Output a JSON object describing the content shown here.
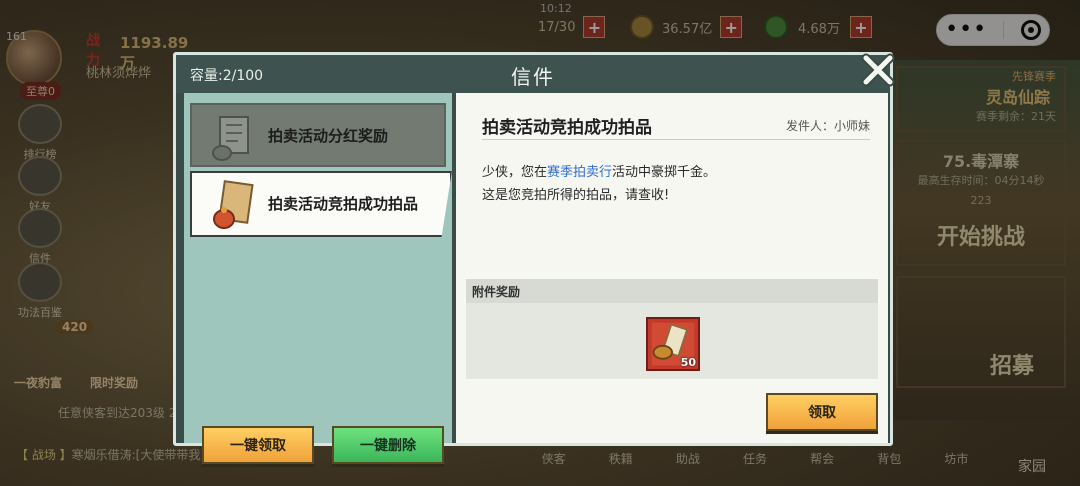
{
  "hud": {
    "level": "161",
    "power_label": "战力",
    "power": "1193.89万",
    "player_name": "桃林须烨烨",
    "rank": "至尊0",
    "timer": "10:12",
    "energy": "17/30",
    "copper": "36.57亿",
    "jade": "4.68万",
    "plus": "+"
  },
  "side_menu": [
    {
      "label": "排行榜"
    },
    {
      "label": "好友"
    },
    {
      "label": "信件"
    },
    {
      "label": "功法百鉴"
    }
  ],
  "bottom": {
    "reward_badge": "420",
    "act_1": "一夜豹富",
    "act_2": "限时奖励",
    "task": "任意侠客到达203级 2",
    "chat_tag": "【 战场 】",
    "chat_text": "寒烟乐借涛:[大使带带我]",
    "nav": [
      "侠客",
      "秩籍",
      "助战",
      "任务",
      "帮会",
      "背包",
      "坊市"
    ],
    "home": "家园"
  },
  "right_panels": {
    "season_tag": "先锋赛季",
    "season_title": "灵岛仙踪",
    "season_sub": "赛季剩余：21天",
    "dungeon_title": "75.毒潭寨",
    "dungeon_sub": "最高生存时间：04分14秒",
    "dungeon_count": "223",
    "challenge": "开始挑战",
    "recruit": "招募"
  },
  "dialog": {
    "capacity": "容量:2/100",
    "title": "信件",
    "mails": [
      {
        "label": "拍卖活动分红奖励",
        "state": "read"
      },
      {
        "label": "拍卖活动竞拍成功拍品",
        "state": "selected"
      }
    ],
    "claim_all": "一键领取",
    "delete_all": "一键删除",
    "detail": {
      "subject": "拍卖活动竞拍成功拍品",
      "sender": "发件人：小师妹",
      "line1_a": "少侠，您在",
      "line1_hl": "赛季拍卖行",
      "line1_b": "活动中豪掷千金。",
      "line2": "这是您竞拍所得的拍品，请查收!",
      "attach_label": "附件奖励",
      "item_qty": "50",
      "claim": "领取"
    }
  },
  "mini_program": {
    "more": "•••"
  },
  "colors": {
    "dialog_frame": "#d7e6e0",
    "list_bg": "#9ec6bd",
    "claim_button": "#f0a23a",
    "delete_button": "#3cb55a",
    "highlight_link": "#2f6fd0"
  }
}
